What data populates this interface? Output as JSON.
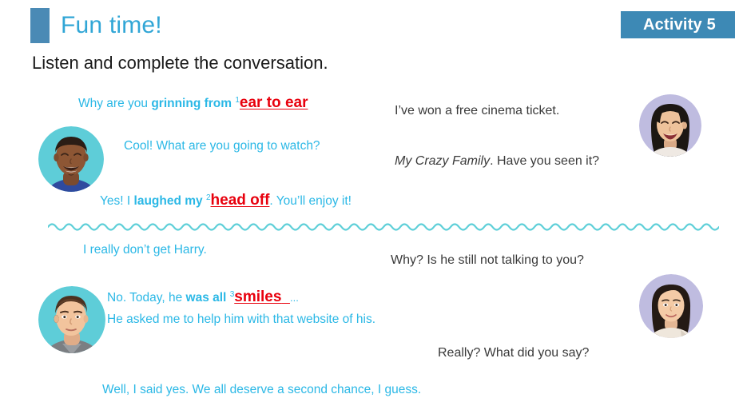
{
  "header": {
    "title": "Fun time!",
    "badge_label": "Activity 5",
    "accent_color": "#4a8ab5",
    "title_color": "#31a6d6",
    "badge_color": "#3d89b5"
  },
  "instruction": "Listen and complete the conversation.",
  "colors": {
    "speech_left": "#2bb8e6",
    "speech_right": "#3a3a3a",
    "answer_red": "#e8000d",
    "wave": "#5ecfd8",
    "avatar_teal": "#5ecdd8",
    "avatar_lavender": "#bfbce0"
  },
  "dialogue_top": {
    "line1": {
      "plain1": "Why are you ",
      "bold1": "grinning from ",
      "superscript": "1",
      "answer": "ear to ear"
    },
    "line2_right": "I’ve won a free cinema ticket.",
    "line3_left": "Cool! What are you going to watch?",
    "line4_right_italic": "My Crazy Family",
    "line4_right_rest": ". Have you seen it?",
    "line5": {
      "plain1": "Yes! I ",
      "bold1": "laughed my ",
      "superscript": "2",
      "answer": "head off",
      "plain2": ". You’ll enjoy it!"
    }
  },
  "dialogue_bottom": {
    "line1_left": "I really don’t get Harry.",
    "line2_right": "Why? Is he still not talking to you?",
    "line3": {
      "plain1": "No. Today, he ",
      "bold1": "was all ",
      "superscript": "3",
      "answer": "smiles",
      "trailing": "..."
    },
    "line4_left": "He asked me to help him with that website of his.",
    "line5_right": "Really? What did you say?",
    "line6_left": "Well, I said yes. We all deserve a second chance, I guess."
  },
  "avatars": {
    "top_left": "avatar-young-man-laughing",
    "top_right": "avatar-young-woman-laughing",
    "bottom_left": "avatar-young-man-neutral",
    "bottom_right": "avatar-young-woman-smiling"
  }
}
